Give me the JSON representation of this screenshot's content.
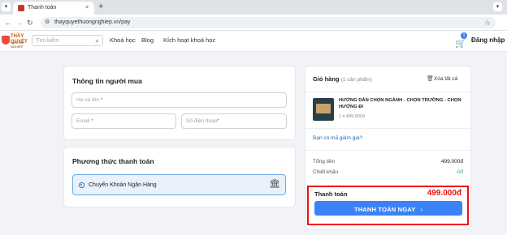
{
  "browser": {
    "tab_title": "Thanh toán",
    "tab_close": "×",
    "new_tab": "+",
    "url": "thayquyethuongnghiep.vn/pay"
  },
  "header": {
    "logo_text": "THẦY QUYẾT",
    "logo_sub": "HƯỚNG NGHIỆP",
    "search_placeholder": "Tìm kiếm",
    "nav": [
      "Khoá học",
      "Blog",
      "Kích hoạt khoá học"
    ],
    "cart_count": "1",
    "login": "Đăng nhập"
  },
  "buyer": {
    "title": "Thông tin người mua",
    "fullname_placeholder": "Họ và tên",
    "email_placeholder": "Email",
    "phone_placeholder": "Số điện thoại",
    "required_mark": "*"
  },
  "payment": {
    "title": "Phương thức thanh toán",
    "option": "Chuyển Khoản Ngân Hàng"
  },
  "cart": {
    "title": "Giỏ hàng",
    "count_label": "(1 sản phẩm)",
    "clear_all": "Xóa tất cả",
    "item": {
      "name": "HƯỚNG DẪN CHỌN NGÀNH - CHỌN TRƯỜNG - CHỌN HƯỚNG ĐI",
      "price": "1 x 499.000đ"
    },
    "coupon": "Bạn có mã giảm giá?",
    "subtotal_label": "Tổng tiền",
    "subtotal_value": "499.000đ",
    "discount_label": "Chiết khấu",
    "discount_value": "-0đ",
    "total_label": "Thanh toán",
    "total_value": "499.000đ",
    "pay_button": "THANH TOÁN NGAY",
    "pay_arrow": "›"
  },
  "colors": {
    "accent": "#3b82f6",
    "highlight": "#e11111",
    "discount": "#27ae60"
  }
}
